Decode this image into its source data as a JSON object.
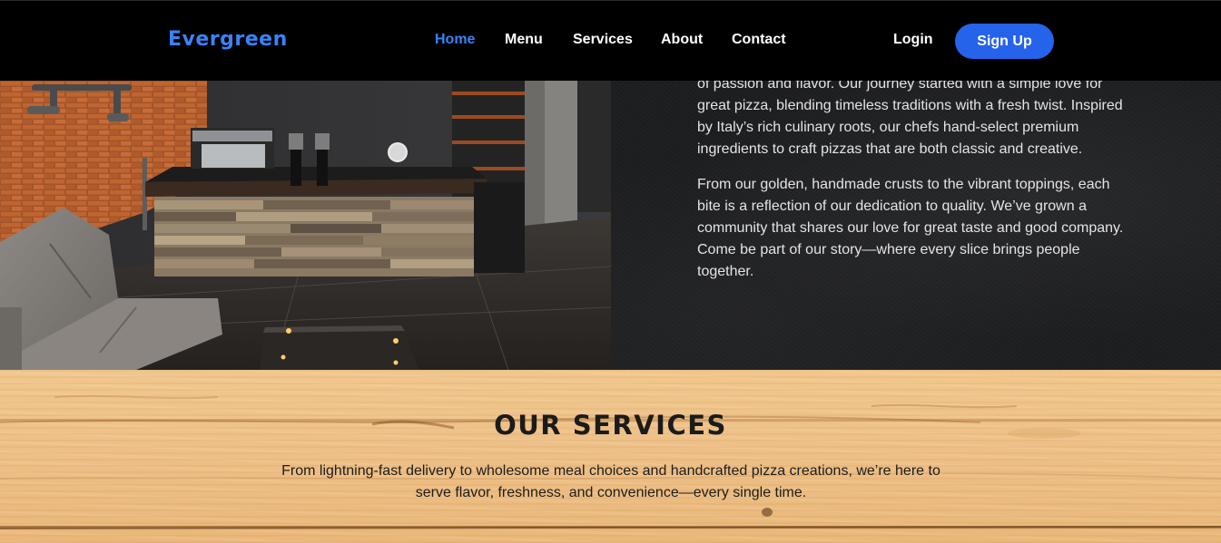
{
  "navbar": {
    "logo": "Evergreen",
    "links": [
      {
        "label": "Home",
        "active": true
      },
      {
        "label": "Menu",
        "active": false
      },
      {
        "label": "Services",
        "active": false
      },
      {
        "label": "About",
        "active": false
      },
      {
        "label": "Contact",
        "active": false
      }
    ],
    "login_label": "Login",
    "signup_label": "Sign Up",
    "accent_color": "#2563eb",
    "active_link_color": "#3b82f6"
  },
  "about": {
    "paragraphs": [
      "of passion and flavor. Our journey started with a simple love for great pizza, blending timeless traditions with a fresh twist. Inspired by Italy’s rich culinary roots, our chefs hand-select premium ingredients to craft pizzas that are both classic and creative.",
      "From our golden, handmade crusts to the vibrant toppings, each bite is a reflection of our dedication to quality. We’ve grown a community that shares our love for great taste and good company. Come be part of our story—where every slice brings people together."
    ]
  },
  "services": {
    "title": "OUR SERVICES",
    "description": "From lightning-fast delivery to wholesome meal choices and handcrafted pizza creations, we’re here to serve flavor, freshness, and convenience—every single time."
  }
}
